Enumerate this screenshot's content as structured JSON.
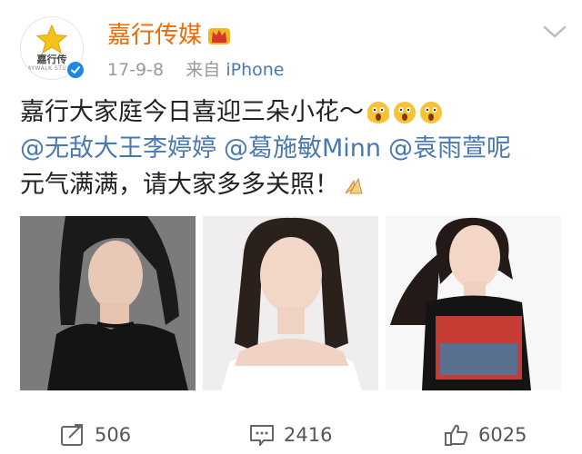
{
  "post": {
    "account_name": "嘉行传媒",
    "avatar_brand": "嘉行传",
    "avatar_brand_sub": "JAYWALK STUDIO",
    "timestamp": "17-9-8",
    "source_prefix": "来自",
    "source_device": "iPhone",
    "text_line1": "嘉行大家庭今日喜迎三朵小花～",
    "mentions": [
      "@无敌大王李婷婷",
      "@葛施敏Minn",
      "@袁雨萱呢"
    ],
    "text_line3": "元气满满，请大家多多关照！",
    "emojis": [
      "scream-emoji",
      "scream-emoji",
      "scream-emoji",
      "pray-hands-emoji"
    ],
    "photos": [
      "photo-woman-black-leather-jacket",
      "photo-woman-white-off-shoulder",
      "photo-woman-graphic-tshirt"
    ]
  },
  "actions": {
    "repost_count": "506",
    "comment_count": "2416",
    "like_count": "6025"
  },
  "colors": {
    "account_name": "#f06a00",
    "link": "#4a78b0",
    "meta": "#9a9a9a",
    "verified": "#1e88e5"
  }
}
